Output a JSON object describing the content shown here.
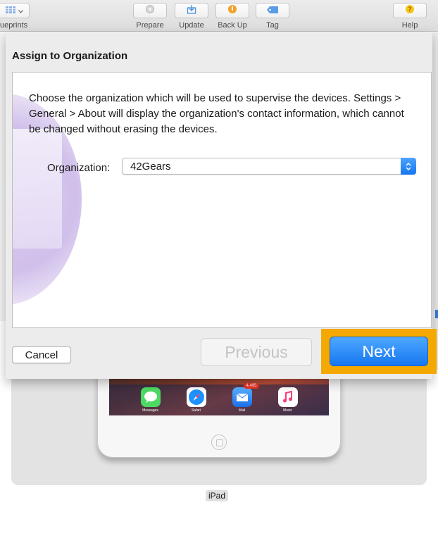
{
  "toolbar": {
    "items": [
      {
        "label": "Blueprints",
        "label_visible": "ueprints",
        "icon": "grid-icon"
      },
      {
        "label": "Prepare",
        "icon": "gear-icon"
      },
      {
        "label": "Update",
        "icon": "update-icon"
      },
      {
        "label": "Back Up",
        "icon": "backup-icon"
      },
      {
        "label": "Tag",
        "icon": "tag-icon"
      },
      {
        "label": "Help",
        "icon": "question-icon"
      }
    ]
  },
  "dialog": {
    "title": "Assign to Organization",
    "description": "Choose the organization which will be used to supervise the devices. Settings > General > About will display the organization's contact information, which cannot be changed without erasing the devices.",
    "organization_label": "Organization:",
    "organization_value": "42Gears",
    "cancel_label": "Cancel",
    "previous_label": "Previous",
    "next_label": "Next"
  },
  "device": {
    "name": "iPad",
    "dock_apps": [
      {
        "label": "Messages",
        "color": "#4cd964"
      },
      {
        "label": "Safari",
        "color": "#1e90ff"
      },
      {
        "label": "Mail",
        "color": "#2a7bf5",
        "badge": "4,495"
      },
      {
        "label": "Music",
        "color": "#ffffff"
      }
    ]
  },
  "colors": {
    "accent": "#1677f0",
    "highlight": "#f5a800",
    "badge": "#ee3322"
  }
}
